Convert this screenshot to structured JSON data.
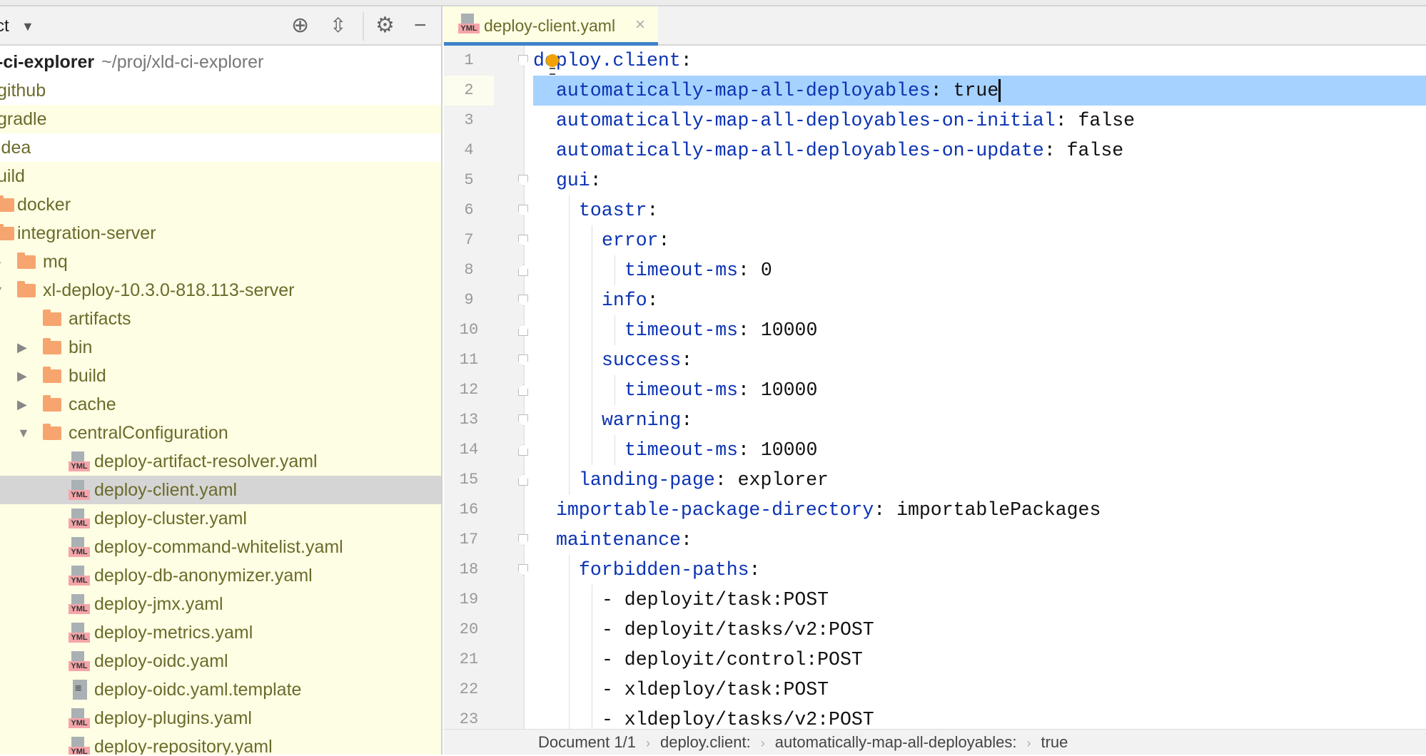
{
  "project_panel": {
    "title_fragment": "ct",
    "header_icons": [
      "locate-icon",
      "collapse-all-icon",
      "gear-icon",
      "minimize-icon"
    ],
    "project_name": "-ci-explorer",
    "project_path": "~/proj/xld-ci-explorer",
    "items": [
      {
        "label": "github",
        "level": 0,
        "type": "none",
        "bg": "white"
      },
      {
        "label": "gradle",
        "level": 0,
        "type": "none",
        "bg": "yellow"
      },
      {
        "label": "idea",
        "level": 0,
        "type": "none",
        "bg": "white"
      },
      {
        "label": "uild",
        "level": 0,
        "type": "none",
        "bg": "yellow"
      },
      {
        "label": "docker",
        "level": 1,
        "type": "folder",
        "bg": "yellow"
      },
      {
        "label": "integration-server",
        "level": 1,
        "type": "folder",
        "bg": "yellow"
      },
      {
        "label": "mq",
        "level": 2,
        "type": "folder",
        "arrow": "collapsed",
        "bg": "yellow"
      },
      {
        "label": "xl-deploy-10.3.0-818.113-server",
        "level": 2,
        "type": "folder",
        "arrow": "expanded",
        "bg": "yellow"
      },
      {
        "label": "artifacts",
        "level": 3,
        "type": "folder",
        "bg": "yellow"
      },
      {
        "label": "bin",
        "level": 3,
        "type": "folder",
        "arrow": "collapsed",
        "bg": "yellow"
      },
      {
        "label": "build",
        "level": 3,
        "type": "folder",
        "arrow": "collapsed",
        "bg": "yellow"
      },
      {
        "label": "cache",
        "level": 3,
        "type": "folder",
        "arrow": "collapsed",
        "bg": "yellow"
      },
      {
        "label": "centralConfiguration",
        "level": 3,
        "type": "folder",
        "arrow": "expanded",
        "bg": "yellow"
      },
      {
        "label": "deploy-artifact-resolver.yaml",
        "level": 4,
        "type": "yaml",
        "bg": "yellow"
      },
      {
        "label": "deploy-client.yaml",
        "level": 4,
        "type": "yaml",
        "bg": "selected"
      },
      {
        "label": "deploy-cluster.yaml",
        "level": 4,
        "type": "yaml",
        "bg": "yellow"
      },
      {
        "label": "deploy-command-whitelist.yaml",
        "level": 4,
        "type": "yaml",
        "bg": "yellow"
      },
      {
        "label": "deploy-db-anonymizer.yaml",
        "level": 4,
        "type": "yaml",
        "bg": "yellow"
      },
      {
        "label": "deploy-jmx.yaml",
        "level": 4,
        "type": "yaml",
        "bg": "yellow"
      },
      {
        "label": "deploy-metrics.yaml",
        "level": 4,
        "type": "yaml",
        "bg": "yellow"
      },
      {
        "label": "deploy-oidc.yaml",
        "level": 4,
        "type": "yaml",
        "bg": "yellow"
      },
      {
        "label": "deploy-oidc.yaml.template",
        "level": 4,
        "type": "text",
        "bg": "yellow"
      },
      {
        "label": "deploy-plugins.yaml",
        "level": 4,
        "type": "yaml",
        "bg": "yellow"
      },
      {
        "label": "deploy-repository.yaml",
        "level": 4,
        "type": "yaml",
        "bg": "yellow"
      }
    ]
  },
  "editor": {
    "tab": {
      "label": "deploy-client.yaml",
      "icon_badge": "YML",
      "close": "×"
    },
    "current_line": 2,
    "lines": [
      {
        "n": "1",
        "indent": 0,
        "key": "deploy.client",
        "sep": ":",
        "value": "",
        "fold": "open"
      },
      {
        "n": "2",
        "indent": 1,
        "key": "automatically-map-all-deployables",
        "sep": ": ",
        "value": "true",
        "fold": ""
      },
      {
        "n": "3",
        "indent": 1,
        "key": "automatically-map-all-deployables-on-initial",
        "sep": ": ",
        "value": "false",
        "fold": ""
      },
      {
        "n": "4",
        "indent": 1,
        "key": "automatically-map-all-deployables-on-update",
        "sep": ": ",
        "value": "false",
        "fold": ""
      },
      {
        "n": "5",
        "indent": 1,
        "key": "gui",
        "sep": ":",
        "value": "",
        "fold": "open"
      },
      {
        "n": "6",
        "indent": 2,
        "key": "toastr",
        "sep": ":",
        "value": "",
        "fold": "open"
      },
      {
        "n": "7",
        "indent": 3,
        "key": "error",
        "sep": ":",
        "value": "",
        "fold": "open"
      },
      {
        "n": "8",
        "indent": 4,
        "key": "timeout-ms",
        "sep": ": ",
        "value": "0",
        "fold": "close"
      },
      {
        "n": "9",
        "indent": 3,
        "key": "info",
        "sep": ":",
        "value": "",
        "fold": "open"
      },
      {
        "n": "10",
        "indent": 4,
        "key": "timeout-ms",
        "sep": ": ",
        "value": "10000",
        "fold": "close"
      },
      {
        "n": "11",
        "indent": 3,
        "key": "success",
        "sep": ":",
        "value": "",
        "fold": "open"
      },
      {
        "n": "12",
        "indent": 4,
        "key": "timeout-ms",
        "sep": ": ",
        "value": "10000",
        "fold": "close"
      },
      {
        "n": "13",
        "indent": 3,
        "key": "warning",
        "sep": ":",
        "value": "",
        "fold": "open"
      },
      {
        "n": "14",
        "indent": 4,
        "key": "timeout-ms",
        "sep": ": ",
        "value": "10000",
        "fold": "close"
      },
      {
        "n": "15",
        "indent": 2,
        "key": "landing-page",
        "sep": ": ",
        "value": "explorer",
        "fold": "close"
      },
      {
        "n": "16",
        "indent": 1,
        "key": "importable-package-directory",
        "sep": ": ",
        "value": "importablePackages",
        "fold": ""
      },
      {
        "n": "17",
        "indent": 1,
        "key": "maintenance",
        "sep": ":",
        "value": "",
        "fold": "open"
      },
      {
        "n": "18",
        "indent": 2,
        "key": "forbidden-paths",
        "sep": ":",
        "value": "",
        "fold": "open"
      },
      {
        "n": "19",
        "indent": 3,
        "key": "",
        "sep": "",
        "value": "- deployit/task:POST",
        "fold": ""
      },
      {
        "n": "20",
        "indent": 3,
        "key": "",
        "sep": "",
        "value": "- deployit/tasks/v2:POST",
        "fold": ""
      },
      {
        "n": "21",
        "indent": 3,
        "key": "",
        "sep": "",
        "value": "- deployit/control:POST",
        "fold": ""
      },
      {
        "n": "22",
        "indent": 3,
        "key": "",
        "sep": "",
        "value": "- xldeploy/task:POST",
        "fold": ""
      },
      {
        "n": "23",
        "indent": 3,
        "key": "",
        "sep": "",
        "value": "- xldeploy/tasks/v2:POST",
        "fold": ""
      }
    ]
  },
  "breadcrumbs": [
    "Document 1/1",
    "deploy.client:",
    "automatically-map-all-deployables:",
    "true"
  ],
  "colors": {
    "key": "#0b33b3",
    "line_highlight": "#a6d2ff",
    "tab_underline": "#4083c9",
    "tree_modified_bg": "#fefee4",
    "folder": "#f6a56f"
  }
}
